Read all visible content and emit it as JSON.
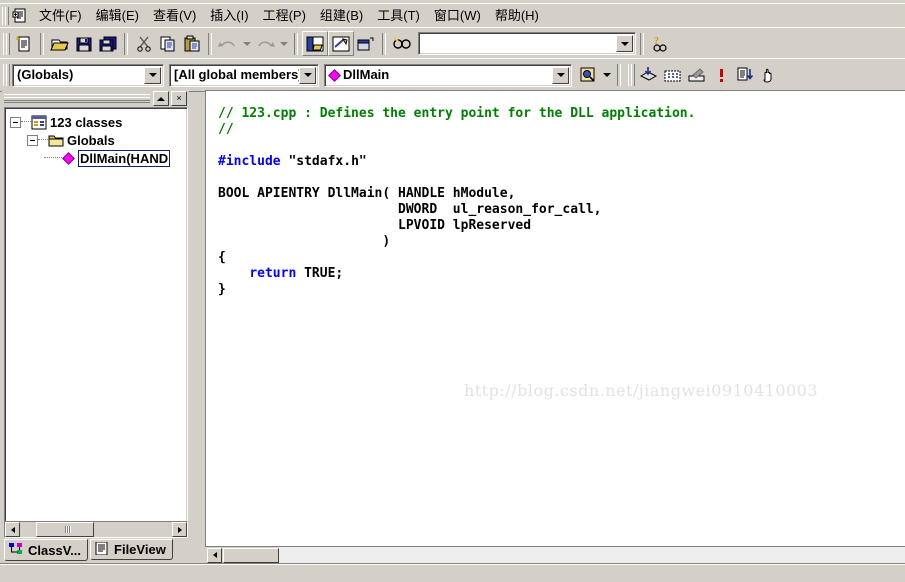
{
  "menubar": {
    "app_icon": "mdi-document-icon",
    "items": [
      {
        "label": "文件(F)",
        "accel": "F",
        "name": "menu-file"
      },
      {
        "label": "编辑(E)",
        "accel": "E",
        "name": "menu-edit"
      },
      {
        "label": "查看(V)",
        "accel": "V",
        "name": "menu-view"
      },
      {
        "label": "插入(I)",
        "accel": "I",
        "name": "menu-insert"
      },
      {
        "label": "工程(P)",
        "accel": "P",
        "name": "menu-project"
      },
      {
        "label": "组建(B)",
        "accel": "B",
        "name": "menu-build"
      },
      {
        "label": "工具(T)",
        "accel": "T",
        "name": "menu-tools"
      },
      {
        "label": "窗口(W)",
        "accel": "W",
        "name": "menu-window"
      },
      {
        "label": "帮助(H)",
        "accel": "H",
        "name": "menu-help"
      }
    ]
  },
  "standard_toolbar": {
    "buttons": [
      "new-file-icon",
      "open-folder-icon",
      "save-icon",
      "save-all-icon",
      "cut-scissors-icon",
      "copy-icon",
      "paste-icon",
      "undo-icon",
      "redo-icon",
      "workspace-window-icon",
      "output-window-icon",
      "window-list-icon",
      "find-in-files-icon"
    ],
    "search_combo": {
      "value": "",
      "placeholder": ""
    },
    "help_button": "help-search-icon"
  },
  "wizardbar": {
    "class_combo": {
      "value": "(Globals)",
      "name": "class-combo"
    },
    "filter_combo": {
      "value": "[All global members]",
      "name": "members-combo"
    },
    "member_combo": {
      "value": "DllMain",
      "icon": "magenta-diamond-icon",
      "name": "member-combo"
    },
    "action_button": "wizardbar-action-icon",
    "buttons": [
      "go-to-definition-icon",
      "new-class-icon",
      "add-function-icon",
      "error-marker-icon",
      "next-item-icon",
      "drag-hand-icon"
    ]
  },
  "workspace": {
    "titlebar": {
      "pin_button": "dock-pin-icon",
      "close_button": "close-icon"
    },
    "tree": [
      {
        "label": "123 classes",
        "icon": "classes-icon",
        "depth": 0,
        "expanded": true,
        "selected": false
      },
      {
        "label": "Globals",
        "icon": "folder-icon",
        "depth": 1,
        "expanded": true,
        "selected": false
      },
      {
        "label": "DllMain(HAND",
        "icon": "magenta-diamond-icon",
        "depth": 2,
        "expanded": null,
        "selected": true
      }
    ],
    "tabs": [
      {
        "label": "ClassV...",
        "icon": "classview-icon",
        "active": true,
        "name": "tab-classview"
      },
      {
        "label": "FileView",
        "icon": "fileview-icon",
        "active": false,
        "name": "tab-fileview"
      }
    ]
  },
  "editor": {
    "watermark": "http://blog.csdn.net/jiangwei0910410003",
    "lines": [
      [
        {
          "t": "// 123.cpp : Defines the entry point for the DLL application.",
          "c": "c-com"
        }
      ],
      [
        {
          "t": "//",
          "c": "c-com"
        }
      ],
      [
        {
          "t": "",
          "c": ""
        }
      ],
      [
        {
          "t": "#include",
          "c": "c-pre"
        },
        {
          "t": " \"stdafx.h\"",
          "c": ""
        }
      ],
      [
        {
          "t": "",
          "c": ""
        }
      ],
      [
        {
          "t": "BOOL APIENTRY DllMain( HANDLE hModule,",
          "c": ""
        }
      ],
      [
        {
          "t": "                       DWORD  ul_reason_for_call,",
          "c": ""
        }
      ],
      [
        {
          "t": "                       LPVOID lpReserved",
          "c": ""
        }
      ],
      [
        {
          "t": "                     )",
          "c": ""
        }
      ],
      [
        {
          "t": "{",
          "c": ""
        }
      ],
      [
        {
          "t": "    ",
          "c": ""
        },
        {
          "t": "return",
          "c": "c-kw"
        },
        {
          "t": " TRUE;",
          "c": ""
        }
      ],
      [
        {
          "t": "}",
          "c": ""
        }
      ]
    ]
  },
  "colors": {
    "face": "#d4d0c8",
    "comment_green": "#008000",
    "keyword_blue": "#0000ff",
    "accent_magenta": "#ff00ff",
    "watermark_gray": "#e2e2e2"
  }
}
